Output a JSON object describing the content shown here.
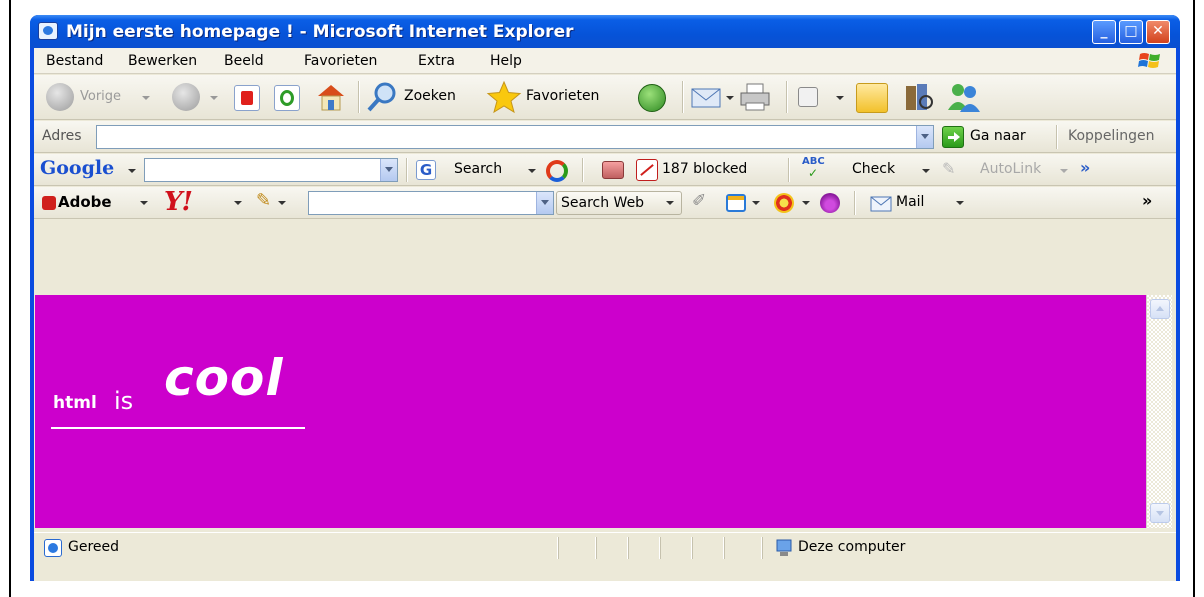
{
  "window": {
    "title": "Mijn eerste homepage ! - Microsoft Internet Explorer",
    "min_glyph": "_",
    "max_glyph": "□",
    "close_glyph": "✕"
  },
  "menu": {
    "items": [
      "Bestand",
      "Bewerken",
      "Beeld",
      "Favorieten",
      "Extra",
      "Help"
    ]
  },
  "standard_toolbar": {
    "back_label": "Vorige",
    "search_label": "Zoeken",
    "favorites_label": "Favorieten"
  },
  "address_bar": {
    "label": "Adres",
    "value": "",
    "go_label": "Ga naar",
    "links_label": "Koppelingen"
  },
  "google_toolbar": {
    "logo": "Google",
    "search_value": "",
    "search_label": "Search",
    "blocked_label": "187 blocked",
    "check_label": "Check",
    "autolink_label": "AutoLink",
    "more_glyph": "»"
  },
  "yahoo_toolbar": {
    "adobe_label": "Adobe",
    "yahoo_logo": "Y!",
    "search_value": "",
    "search_web_label": "Search Web",
    "mail_label": "Mail",
    "more_glyph": "»"
  },
  "page": {
    "background": "#cc00cc",
    "word_1": "html",
    "word_2": "is",
    "word_3": "cool"
  },
  "statusbar": {
    "status": "Gereed",
    "zone": "Deze computer"
  },
  "colors": {
    "titlebar": "#0653d8",
    "close_button": "#d2421c",
    "chrome": "#ece9d8"
  }
}
